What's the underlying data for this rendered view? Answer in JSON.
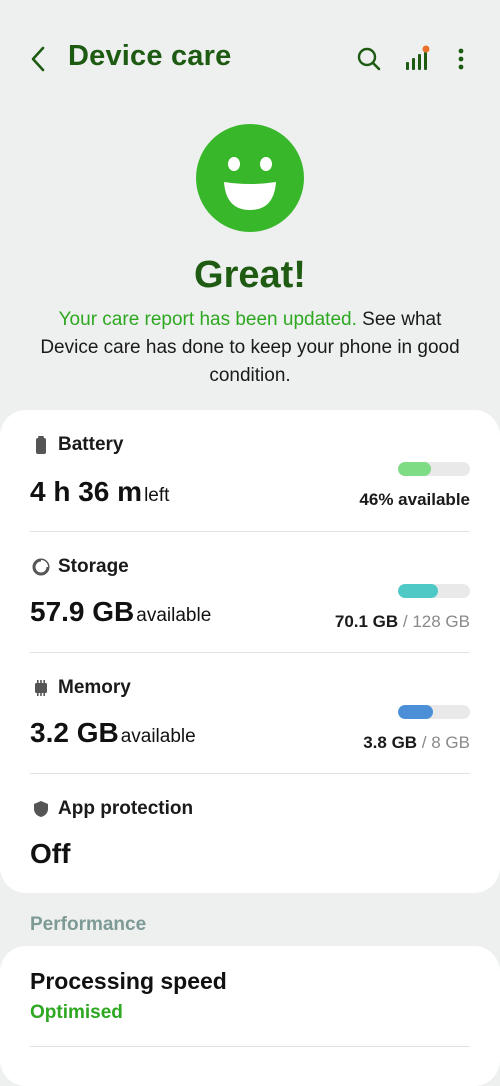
{
  "header": {
    "title": "Device care",
    "back_icon": "chevron-left-icon",
    "actions": [
      "search-icon",
      "signal-bars-icon",
      "more-vert-icon"
    ],
    "notification_dot_color": "#e8702a"
  },
  "hero": {
    "face_color": "#38b72b",
    "status": "Great!",
    "report_highlight": "Your care report has been updated.",
    "report_rest": " See what Device care has done to keep your phone in good condition."
  },
  "items": [
    {
      "label": "Battery",
      "icon": "battery-icon",
      "value": "4 h 36 m",
      "unit": "left",
      "right_strong": "46% available",
      "right_muted": "",
      "fraction": 0.46,
      "bar_color": "#7edc84"
    },
    {
      "label": "Storage",
      "icon": "storage-pie-icon",
      "value": "57.9 GB",
      "unit": "available",
      "right_strong": "70.1 GB",
      "right_muted": " / 128 GB",
      "fraction": 0.55,
      "bar_color": "#4ec9c6"
    },
    {
      "label": "Memory",
      "icon": "memory-chip-icon",
      "value": "3.2 GB",
      "unit": "available",
      "right_strong": "3.8 GB",
      "right_muted": " / 8 GB",
      "fraction": 0.48,
      "bar_color": "#4a8fd8"
    },
    {
      "label": "App protection",
      "icon": "shield-icon",
      "value": "Off",
      "unit": ""
    }
  ],
  "performance": {
    "section_title": "Performance",
    "title": "Processing speed",
    "status": "Optimised"
  }
}
